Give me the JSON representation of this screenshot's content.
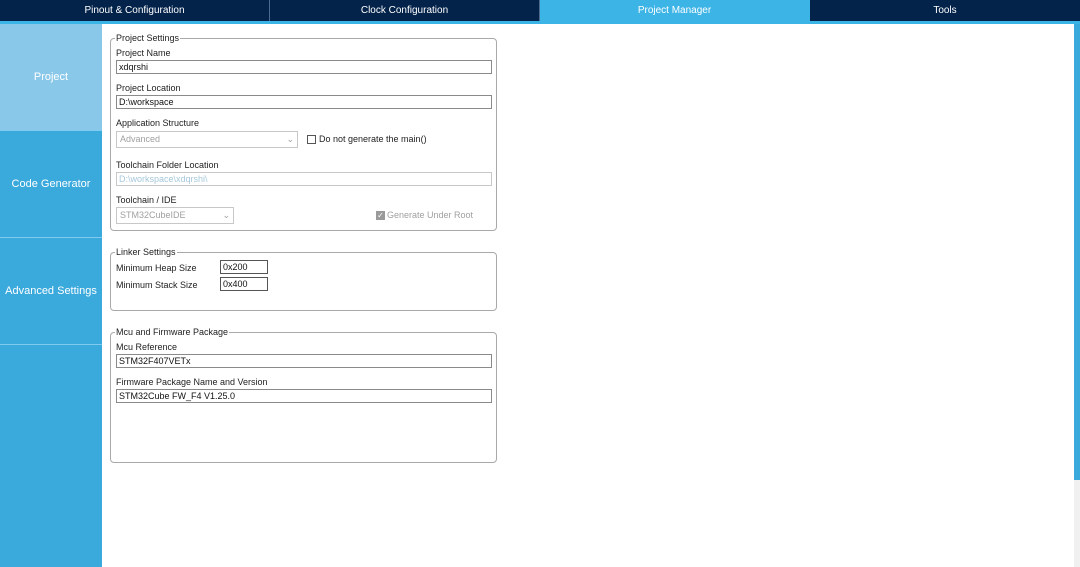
{
  "top_tabs": [
    {
      "label": "Pinout & Configuration",
      "active": false
    },
    {
      "label": "Clock Configuration",
      "active": false
    },
    {
      "label": "Project Manager",
      "active": true
    },
    {
      "label": "Tools",
      "active": false
    }
  ],
  "side_nav": [
    {
      "label": "Project",
      "active": true
    },
    {
      "label": "Code Generator",
      "active": false
    },
    {
      "label": "Advanced Settings",
      "active": false
    }
  ],
  "project_settings": {
    "legend": "Project Settings",
    "project_name_label": "Project Name",
    "project_name_value": "xdqrshi",
    "project_location_label": "Project Location",
    "project_location_value": "D:\\workspace",
    "app_structure_label": "Application Structure",
    "app_structure_value": "Advanced",
    "no_main_label": "Do not generate the main()",
    "no_main_checked": false,
    "toolchain_folder_label": "Toolchain Folder Location",
    "toolchain_folder_value": "D:\\workspace\\xdqrshi\\",
    "toolchain_ide_label": "Toolchain / IDE",
    "toolchain_ide_value": "STM32CubeIDE",
    "generate_under_root_label": "Generate Under Root",
    "generate_under_root_checked": true
  },
  "linker_settings": {
    "legend": "Linker Settings",
    "heap_label": "Minimum Heap Size",
    "heap_value": "0x200",
    "stack_label": "Minimum Stack Size",
    "stack_value": "0x400"
  },
  "mcu_firmware": {
    "legend": "Mcu and Firmware Package",
    "mcu_ref_label": "Mcu Reference",
    "mcu_ref_value": "STM32F407VETx",
    "fw_label": "Firmware Package Name and Version",
    "fw_value": "STM32Cube FW_F4 V1.25.0"
  },
  "colors": {
    "top_bar": "#03234b",
    "accent": "#3cb4e6",
    "side_nav": "#3aa9dc",
    "side_nav_active": "#8ac8ea"
  }
}
